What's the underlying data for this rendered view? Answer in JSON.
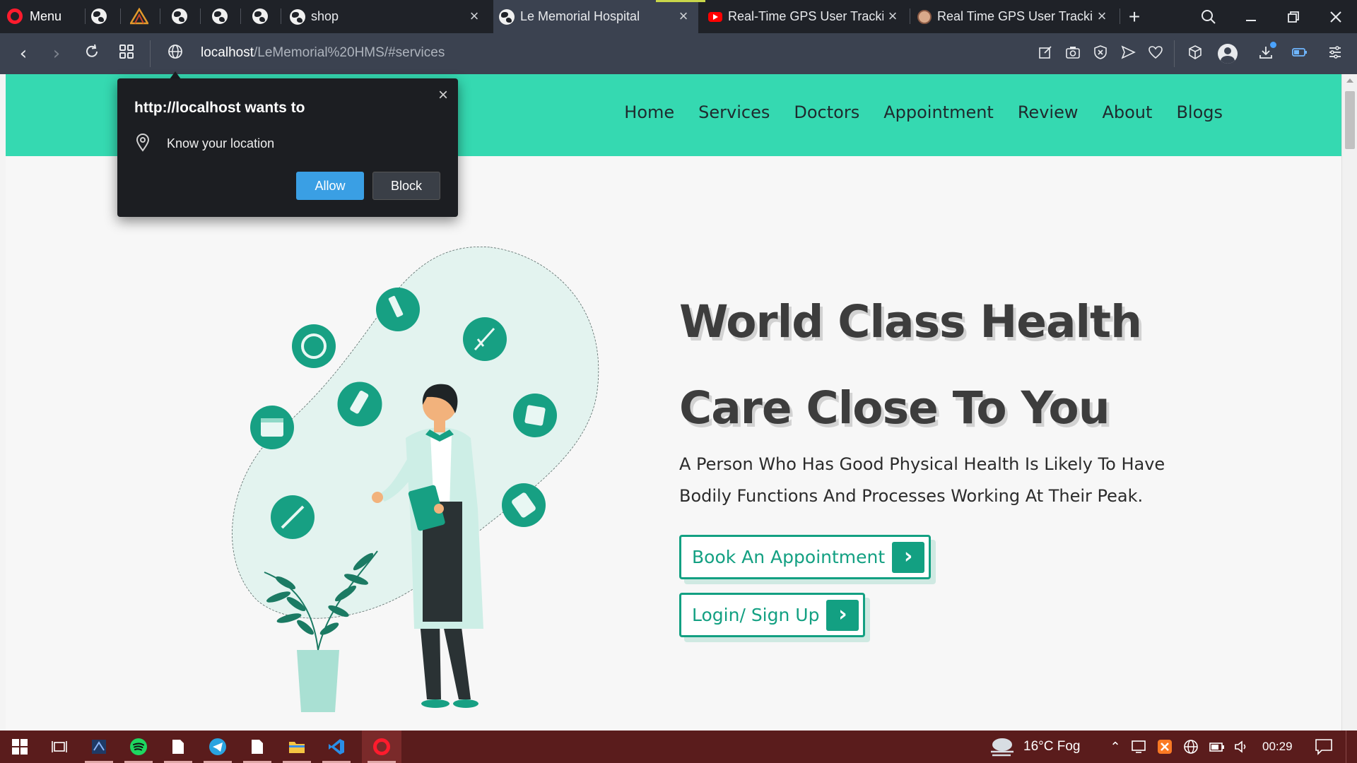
{
  "browser": {
    "menu_label": "Menu",
    "tabs": [
      {
        "title": "shop"
      },
      {
        "title": "Le Memorial Hospital"
      },
      {
        "title": "Real-Time GPS User Trackin"
      },
      {
        "title": "Real Time GPS User Trackin"
      }
    ],
    "url_host": "localhost",
    "url_path": "/LeMemorial%20HMS/#services"
  },
  "site": {
    "nav": [
      "Home",
      "Services",
      "Doctors",
      "Appointment",
      "Review",
      "About",
      "Blogs"
    ],
    "hero_title_line1": "World Class Health",
    "hero_title_line2": "Care Close To You",
    "hero_subtitle": "A Person Who Has Good Physical Health Is Likely To Have Bodily Functions And Processes Working At Their Peak.",
    "cta_primary": "Book An Appointment",
    "cta_secondary": "Login/ Sign Up",
    "accent_color": "#35d9b1",
    "brand_color": "#13a082"
  },
  "permission_popup": {
    "title": "http://localhost wants to",
    "permission": "Know your location",
    "allow_label": "Allow",
    "block_label": "Block"
  },
  "taskbar": {
    "weather": "16°C  Fog",
    "time": "00:29"
  }
}
